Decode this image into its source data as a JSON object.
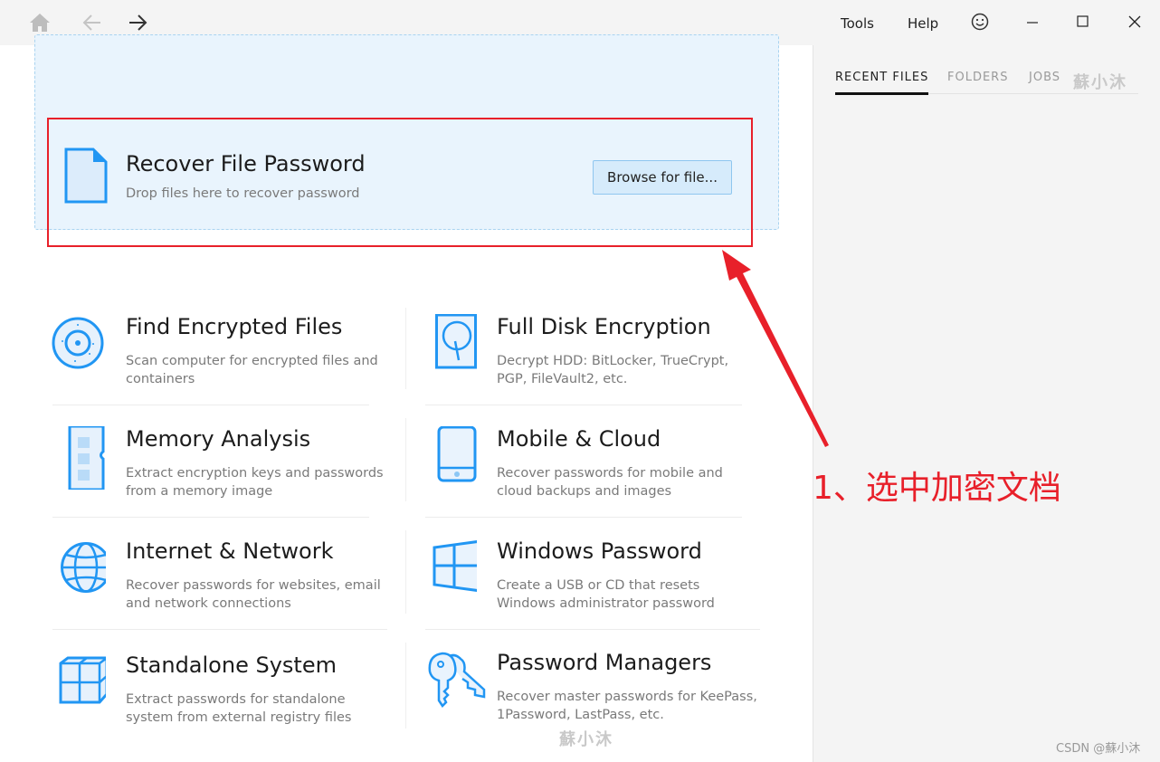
{
  "titlebar": {
    "nav": {
      "home": "home-icon",
      "back": "arrow-left-icon",
      "forward": "arrow-right-icon"
    },
    "menu": {
      "tools": "Tools",
      "help": "Help"
    },
    "feedback_icon": "smiley-icon",
    "window_controls": {
      "minimize": "minimize-icon",
      "maximize": "maximize-icon",
      "close": "close-icon"
    }
  },
  "dropzone": {
    "title": "Recover File Password",
    "subtitle": "Drop files here to recover password",
    "browse_label": "Browse for file...",
    "icon": "file-icon"
  },
  "tiles": [
    {
      "title": "Find Encrypted Files",
      "desc": "Scan computer for encrypted files and containers",
      "icon": "disc-scan-icon"
    },
    {
      "title": "Full Disk Encryption",
      "desc": "Decrypt HDD: BitLocker, TrueCrypt, PGP, FileVault2, etc.",
      "icon": "hard-disk-icon"
    },
    {
      "title": "Memory Analysis",
      "desc": "Extract encryption keys and passwords from a memory image",
      "icon": "memory-module-icon"
    },
    {
      "title": "Mobile & Cloud",
      "desc": "Recover passwords for mobile and cloud backups and images",
      "icon": "mobile-device-icon"
    },
    {
      "title": "Internet & Network",
      "desc": "Recover passwords for websites, email and network connections",
      "icon": "globe-icon"
    },
    {
      "title": "Windows Password",
      "desc": "Create a USB or CD that resets Windows administrator password",
      "icon": "windows-logo-icon"
    },
    {
      "title": "Standalone System",
      "desc": "Extract passwords for standalone system from external registry files",
      "icon": "cubes-icon"
    },
    {
      "title": "Password Managers",
      "desc": "Recover master passwords for KeePass, 1Password, LastPass, etc.",
      "icon": "keys-icon"
    }
  ],
  "sidepanel": {
    "tabs": [
      {
        "label": "RECENT FILES",
        "active": true
      },
      {
        "label": "FOLDERS",
        "active": false
      },
      {
        "label": "JOBS",
        "active": false
      }
    ]
  },
  "annotation": {
    "text": "1、选中加密文档",
    "color": "#e8202a"
  },
  "watermarks": {
    "top": "蘇小沐",
    "bottom": "蘇小沐",
    "csdn": "CSDN @蘇小沐"
  },
  "colors": {
    "accent": "#2196f3",
    "dropzone_bg": "#e9f4fd",
    "annotation": "#e8202a"
  }
}
